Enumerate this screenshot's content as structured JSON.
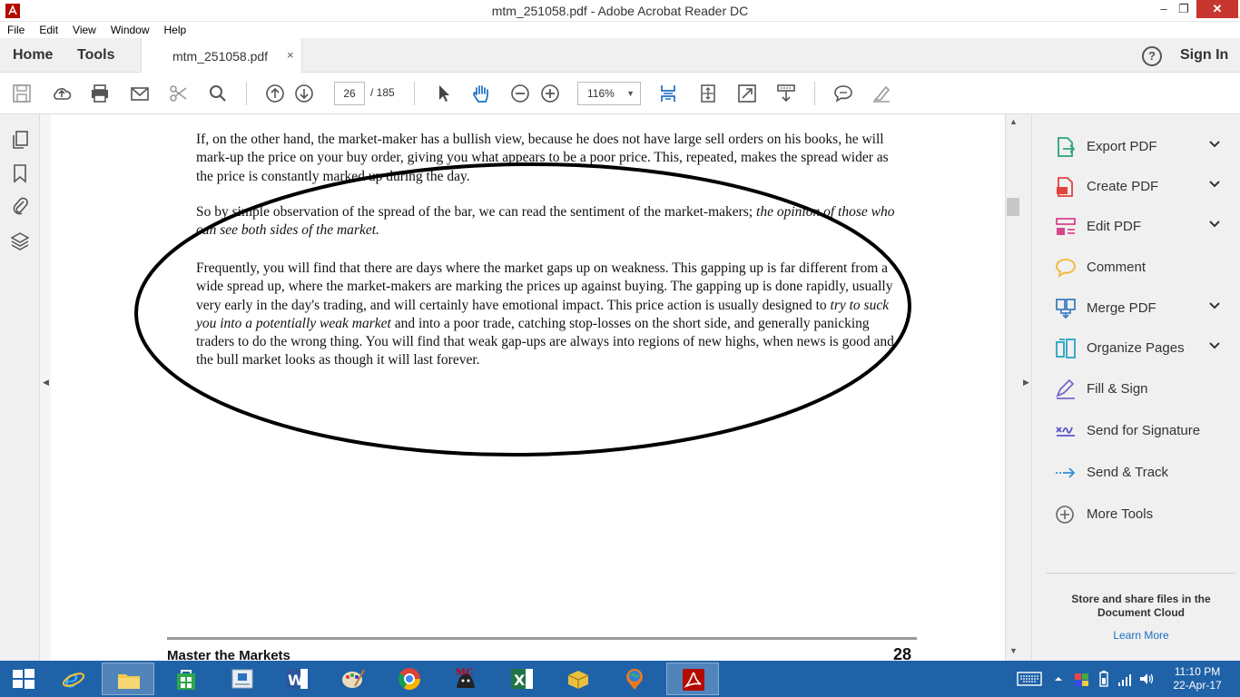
{
  "window": {
    "title": "mtm_251058.pdf - Adobe Acrobat Reader DC",
    "min_glyph": "–",
    "max_glyph": "❐",
    "close_glyph": "✕"
  },
  "menu": [
    "File",
    "Edit",
    "View",
    "Window",
    "Help"
  ],
  "tabs": {
    "home": "Home",
    "tools": "Tools",
    "document": "mtm_251058.pdf",
    "close_glyph": "×",
    "help_glyph": "?",
    "sign_in": "Sign In"
  },
  "toolbar": {
    "page_current": "26",
    "page_total": "/ 185",
    "zoom": "116%",
    "zoom_caret": "▼"
  },
  "document": {
    "para1": "If, on the other hand, the market-maker has a bullish view, because he does not have large sell orders on his books, he will mark-up  the price on your buy order, giving you what appears to be a poor price.  This, repeated, makes the spread wider as the price is constantly marked up during the day.",
    "para2_plain": "So by simple observation of the spread of the bar, we can read the sentiment of the market-makers; ",
    "para2_italic": "the opinion of those who can see both sides of the market.",
    "para3_a": "Frequently, you will find that there are days where the market gaps up on weakness.  This gapping up is far different from a wide spread up, where the market-makers are marking the prices up against buying.  The gapping up is done rapidly, usually very early in the day's trading, and will certainly have emotional impact.  This price action is usually designed to ",
    "para3_italic": "try to suck you into a potentially weak market",
    "para3_b": " and into a poor trade, catching stop-losses on the short side, and generally panicking traders to do the wrong thing.  You will find that weak gap-ups are always into regions of new highs, when news is good and the bull market looks as though it will last forever.",
    "footer_title": "Master the Markets",
    "footer_page": "28"
  },
  "tools_panel": {
    "items": [
      {
        "label": "Export PDF",
        "expandable": true,
        "color": "#2aa37c"
      },
      {
        "label": "Create PDF",
        "expandable": true,
        "color": "#e0443e"
      },
      {
        "label": "Edit PDF",
        "expandable": true,
        "color": "#d9458d"
      },
      {
        "label": "Comment",
        "expandable": false,
        "color": "#f2b632"
      },
      {
        "label": "Merge PDF",
        "expandable": true,
        "color": "#3f7fc1"
      },
      {
        "label": "Organize Pages",
        "expandable": true,
        "color": "#29a3c4"
      },
      {
        "label": "Fill & Sign",
        "expandable": false,
        "color": "#7b68c9"
      },
      {
        "label": "Send for Signature",
        "expandable": false,
        "color": "#5b54c9"
      },
      {
        "label": "Send & Track",
        "expandable": false,
        "color": "#2f8fd6"
      },
      {
        "label": "More Tools",
        "expandable": false,
        "color": "#666666"
      }
    ],
    "cloud_text": "Store and share files in the Document Cloud",
    "learn_more": "Learn More"
  },
  "scroll": {
    "up": "▲",
    "down": "▼"
  },
  "collapse": {
    "left": "◀",
    "right": "▶"
  },
  "taskbar": {
    "time": "11:10 PM",
    "date": "22-Apr-17"
  },
  "colors": {
    "taskbar": "#1f62a8",
    "close_button": "#c7372f",
    "link": "#1a6fc4"
  }
}
